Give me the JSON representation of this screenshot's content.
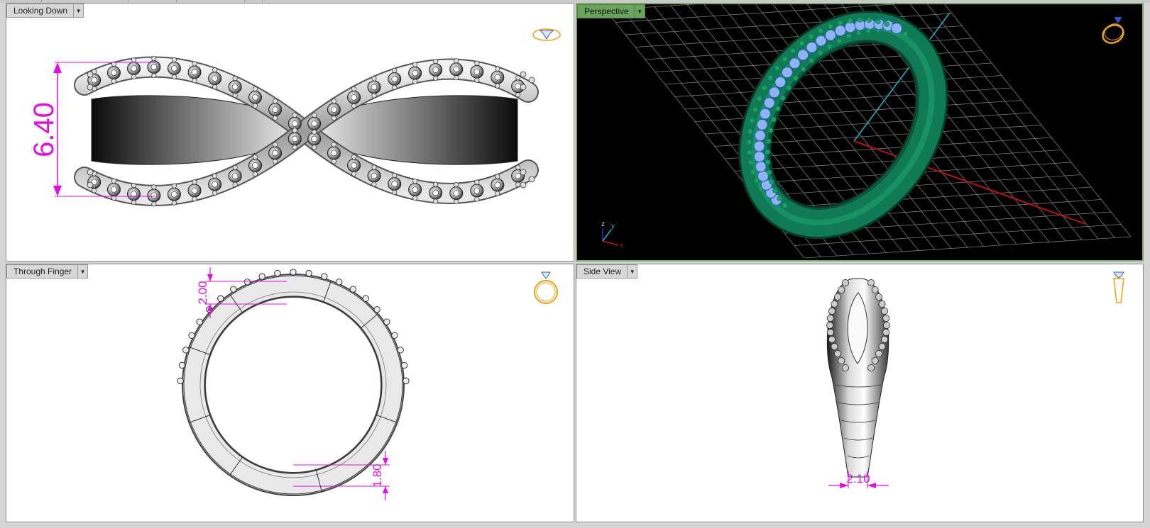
{
  "viewports": {
    "top": {
      "label": "Looking Down",
      "dimension": "6.40"
    },
    "perspective": {
      "label": "Perspective",
      "axes": {
        "z": "z",
        "y": "y",
        "x": "x"
      }
    },
    "front": {
      "label": "Through Finger",
      "dimension_top": "2.00",
      "dimension_bottom": "1.80"
    },
    "side": {
      "label": "Side View",
      "dimension": "2.10"
    }
  },
  "icons": {
    "dropdown": "chevron-down-icon",
    "top_view": "diamond-ring-top-icon",
    "perspective_view": "ring-perspective-icon",
    "front_view": "ring-front-icon",
    "side_view": "ring-side-icon"
  },
  "colors": {
    "dimension": "#e20ee2",
    "active_viewport": "#6aa35b",
    "metal_shaded": "#0f7a55",
    "gem_shaded": "#8fb4f5",
    "prong_shaded": "#1f9c6b",
    "grid": "#8a8a8a",
    "axis_x": "#d01010",
    "axis_y": "#2ab0c8",
    "view_icon": "#f0a010"
  }
}
